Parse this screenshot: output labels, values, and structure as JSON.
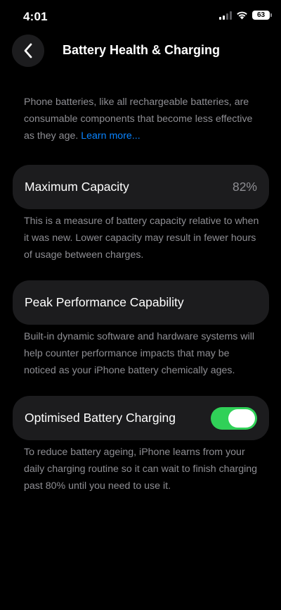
{
  "status_bar": {
    "time": "4:01",
    "battery_level": "63"
  },
  "header": {
    "title": "Battery Health & Charging"
  },
  "intro": {
    "text": "Phone batteries, like all rechargeable batteries, are consumable components that become less effective as they age.",
    "link_label": "Learn more..."
  },
  "maximum_capacity": {
    "label": "Maximum Capacity",
    "value": "82%",
    "description": "This is a measure of battery capacity relative to when it was new. Lower capacity may result in fewer hours of usage between charges."
  },
  "peak_performance": {
    "label": "Peak Performance Capability",
    "description": "Built-in dynamic software and hardware systems will help counter performance impacts that may be noticed as your iPhone battery chemically ages."
  },
  "optimised_charging": {
    "label": "Optimised Battery Charging",
    "enabled": true,
    "description": "To reduce battery ageing, iPhone learns from your daily charging routine so it can wait to finish charging past 80% until you need to use it."
  },
  "colors": {
    "background": "#000000",
    "card": "#1c1c1e",
    "secondary_text": "#8e8e93",
    "link": "#0a84ff",
    "toggle_on": "#30d158"
  }
}
